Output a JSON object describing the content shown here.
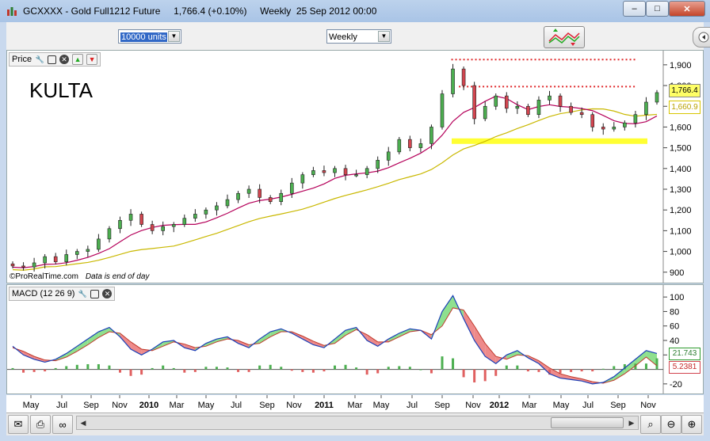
{
  "window": {
    "title": "GCXXXX - Gold Full1212 Future     1,766.4 (+0.10%)     Weekly  25 Sep 2012 00:00",
    "btn_min": "–",
    "btn_max": "□",
    "btn_close": "✕"
  },
  "toolbar": {
    "units_value": "10000 units",
    "period_value": "Weekly"
  },
  "price_panel": {
    "label": "Price",
    "annotation": "KULTA",
    "footer_brand": "©ProRealTime.com",
    "footer_note": "Data is end of day",
    "last_price": "1,766.4",
    "ma_value": "1,660.9",
    "colors": {
      "up": "#4caf50",
      "down": "#d2454f",
      "ma_fast": "#b5005a",
      "ma_slow": "#c9b800",
      "resistance": "#e0282b",
      "support": "#ffff33"
    }
  },
  "macd_panel": {
    "label": "MACD (12 26 9)",
    "macd_value": "21.743",
    "signal_value": "5.2381"
  },
  "x_axis": {
    "labels": [
      "May",
      "Jul",
      "Sep",
      "Nov",
      "2010",
      "Mar",
      "May",
      "Jul",
      "Sep",
      "Nov",
      "2011",
      "Mar",
      "May",
      "Jul",
      "Sep",
      "Nov",
      "2012",
      "Mar",
      "May",
      "Jul",
      "Sep",
      "Nov"
    ]
  },
  "chart_data": [
    {
      "type": "candlestick",
      "title": "Price",
      "annotation": "KULTA",
      "ylim": [
        880,
        1930
      ],
      "y_ticks": [
        "1,900",
        "1,800",
        "1,700",
        "1,600",
        "1,500",
        "1,400",
        "1,300",
        "1,200",
        "1,100",
        "1,000",
        "900"
      ],
      "x_ticks": [
        "May",
        "Jul",
        "Sep",
        "Nov",
        "2010",
        "Mar",
        "May",
        "Jul",
        "Sep",
        "Nov",
        "2011",
        "Mar",
        "May",
        "Jul",
        "Sep",
        "Nov",
        "2012",
        "Mar",
        "May",
        "Jul",
        "Sep",
        "Nov"
      ],
      "series": [
        {
          "name": "Gold close",
          "values": [
            930,
            925,
            945,
            975,
            950,
            985,
            1000,
            1010,
            1060,
            1110,
            1150,
            1180,
            1130,
            1100,
            1120,
            1130,
            1160,
            1180,
            1200,
            1220,
            1250,
            1280,
            1300,
            1260,
            1240,
            1280,
            1330,
            1370,
            1390,
            1380,
            1400,
            1370,
            1370,
            1400,
            1440,
            1480,
            1540,
            1500,
            1520,
            1600,
            1760,
            1880,
            1800,
            1640,
            1700,
            1750,
            1690,
            1700,
            1660,
            1730,
            1750,
            1700,
            1670,
            1660,
            1600,
            1590,
            1600,
            1620,
            1660,
            1720,
            1766
          ]
        }
      ],
      "levels": [
        {
          "type": "resistance",
          "value": 1925
        },
        {
          "type": "resistance",
          "value": 1795
        },
        {
          "type": "support",
          "value": 1530
        }
      ],
      "last_price": 1766.4,
      "moving_average": 1660.9
    },
    {
      "type": "macd",
      "title": "MACD (12 26 9)",
      "ylim": [
        -30,
        110
      ],
      "y_ticks": [
        "100",
        "80",
        "60",
        "40",
        "20",
        "-20"
      ],
      "series": [
        {
          "name": "MACD",
          "values": [
            32,
            20,
            14,
            10,
            14,
            22,
            32,
            42,
            52,
            58,
            45,
            28,
            20,
            28,
            38,
            40,
            30,
            26,
            36,
            42,
            45,
            36,
            30,
            42,
            52,
            56,
            50,
            42,
            34,
            30,
            42,
            54,
            58,
            40,
            32,
            42,
            50,
            56,
            54,
            42,
            80,
            102,
            70,
            40,
            18,
            8,
            20,
            26,
            16,
            8,
            -6,
            -12,
            -14,
            -16,
            -20,
            -18,
            -10,
            2,
            14,
            26,
            22
          ]
        },
        {
          "name": "Signal",
          "values": [
            30,
            25,
            18,
            13,
            12,
            17,
            25,
            34,
            44,
            52,
            50,
            38,
            28,
            26,
            32,
            38,
            35,
            30,
            32,
            38,
            42,
            40,
            34,
            36,
            45,
            52,
            52,
            46,
            39,
            33,
            36,
            47,
            55,
            48,
            38,
            38,
            45,
            52,
            54,
            48,
            60,
            85,
            82,
            60,
            36,
            18,
            14,
            20,
            19,
            12,
            2,
            -6,
            -10,
            -13,
            -17,
            -19,
            -15,
            -6,
            5,
            17,
            5
          ]
        }
      ],
      "macd_value": 21.743,
      "signal_value": 5.2381
    }
  ]
}
